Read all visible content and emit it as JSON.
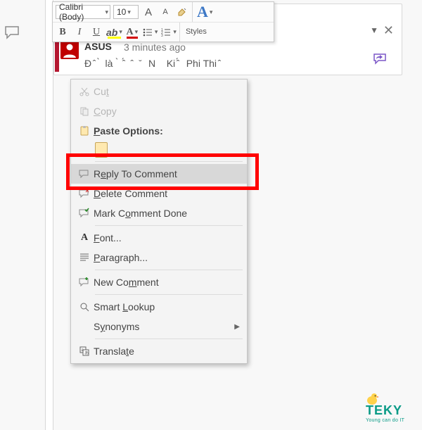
{
  "mini_toolbar": {
    "font_name": "Calibri (Body)",
    "font_size": "10",
    "grow_hint": "A",
    "shrink_hint": "A",
    "styles_label": "Styles",
    "bold": "B",
    "italic": "I",
    "underline": "U"
  },
  "comment": {
    "author": "ASUS",
    "timestamp": "3 minutes ago",
    "text_preview": "Đ ̂  ̀  là  ̀  ̂́   ̂   ̆   N    Ki ̂́   Phi Thi ̂"
  },
  "panel_controls": {
    "pin": "▼",
    "close": "✕"
  },
  "context_menu": {
    "items": [
      {
        "id": "cut",
        "label_pre": "Cu",
        "mnemonic": "t",
        "label_post": "",
        "disabled": true
      },
      {
        "id": "copy",
        "label_pre": "",
        "mnemonic": "C",
        "label_post": "opy",
        "disabled": true
      },
      {
        "id": "paste_options",
        "label_pre": "",
        "mnemonic": "P",
        "label_post": "aste Options:",
        "bold": true
      },
      {
        "id": "reply",
        "label_pre": "R",
        "mnemonic": "e",
        "label_post": "ply To Comment",
        "hover": true
      },
      {
        "id": "delete",
        "label_pre": "",
        "mnemonic": "D",
        "label_post": "elete Comment"
      },
      {
        "id": "done",
        "label_pre": "Mark C",
        "mnemonic": "o",
        "label_post": "mment Done"
      },
      {
        "id": "font",
        "label_pre": "",
        "mnemonic": "F",
        "label_post": "ont..."
      },
      {
        "id": "paragraph",
        "label_pre": "",
        "mnemonic": "P",
        "label_post": "aragraph..."
      },
      {
        "id": "new_comment",
        "label_pre": "New Co",
        "mnemonic": "m",
        "label_post": "ment"
      },
      {
        "id": "smart_lookup",
        "label_pre": "Smart ",
        "mnemonic": "L",
        "label_post": "ookup"
      },
      {
        "id": "synonyms",
        "label_pre": "S",
        "mnemonic": "y",
        "label_post": "nonyms",
        "submenu": true
      },
      {
        "id": "translate",
        "label_pre": "Transla",
        "mnemonic": "t",
        "label_post": "e"
      }
    ]
  },
  "watermark": {
    "name": "TEKY",
    "tagline": "Young can do IT"
  }
}
